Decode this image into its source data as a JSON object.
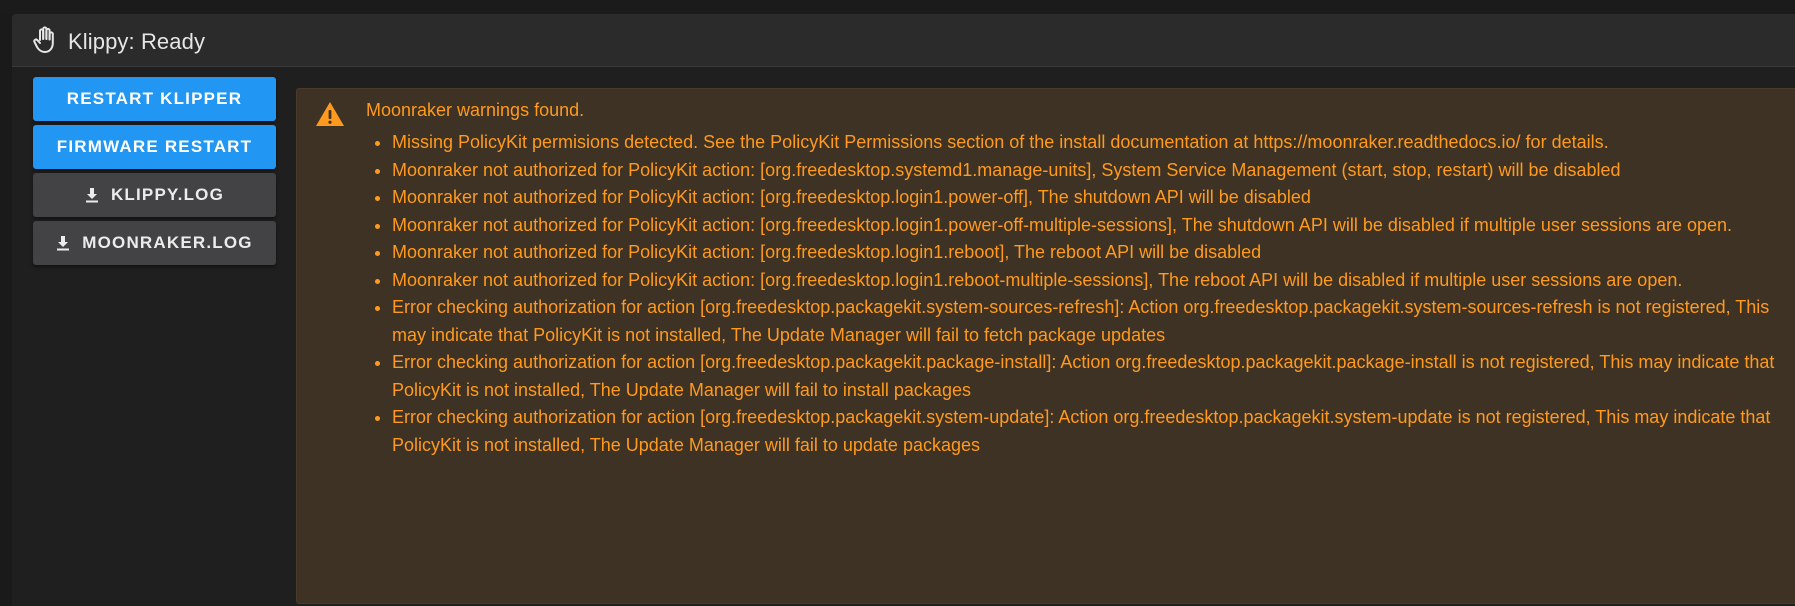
{
  "header": {
    "title": "Klippy: Ready",
    "icon": "hand-icon"
  },
  "actions": {
    "restart_klipper": "RESTART KLIPPER",
    "firmware_restart": "FIRMWARE RESTART",
    "klippy_log": "KLIPPY.LOG",
    "moonraker_log": "MOONRAKER.LOG"
  },
  "alert": {
    "icon": "warning-icon",
    "title": "Moonraker warnings found.",
    "items": [
      "Missing PolicyKit permisions detected. See the PolicyKit Permissions section of the install documentation at https://moonraker.readthedocs.io/ for details.",
      "Moonraker not authorized for PolicyKit action: [org.freedesktop.systemd1.manage-units], System Service Management (start, stop, restart) will be disabled",
      "Moonraker not authorized for PolicyKit action: [org.freedesktop.login1.power-off], The shutdown API will be disabled",
      "Moonraker not authorized for PolicyKit action: [org.freedesktop.login1.power-off-multiple-sessions], The shutdown API will be disabled if multiple user sessions are open.",
      "Moonraker not authorized for PolicyKit action: [org.freedesktop.login1.reboot], The reboot API will be disabled",
      "Moonraker not authorized for PolicyKit action: [org.freedesktop.login1.reboot-multiple-sessions], The reboot API will be disabled if multiple user sessions are open.",
      "Error checking authorization for action [org.freedesktop.packagekit.system-sources-refresh]: Action org.freedesktop.packagekit.system-sources-refresh is not registered, This may indicate that PolicyKit is not installed, The Update Manager will fail to fetch package updates",
      "Error checking authorization for action [org.freedesktop.packagekit.package-install]: Action org.freedesktop.packagekit.package-install is not registered, This may indicate that PolicyKit is not installed, The Update Manager will fail to install packages",
      "Error checking authorization for action [org.freedesktop.packagekit.system-update]: Action org.freedesktop.packagekit.system-update is not registered, This may indicate that PolicyKit is not installed, The Update Manager will fail to update packages"
    ]
  },
  "colors": {
    "primary": "#2196f3",
    "warning": "#ff9a1e",
    "alert_bg": "#3e3224",
    "panel_bg": "#1f1f1f",
    "header_bg": "#2b2b2c"
  }
}
